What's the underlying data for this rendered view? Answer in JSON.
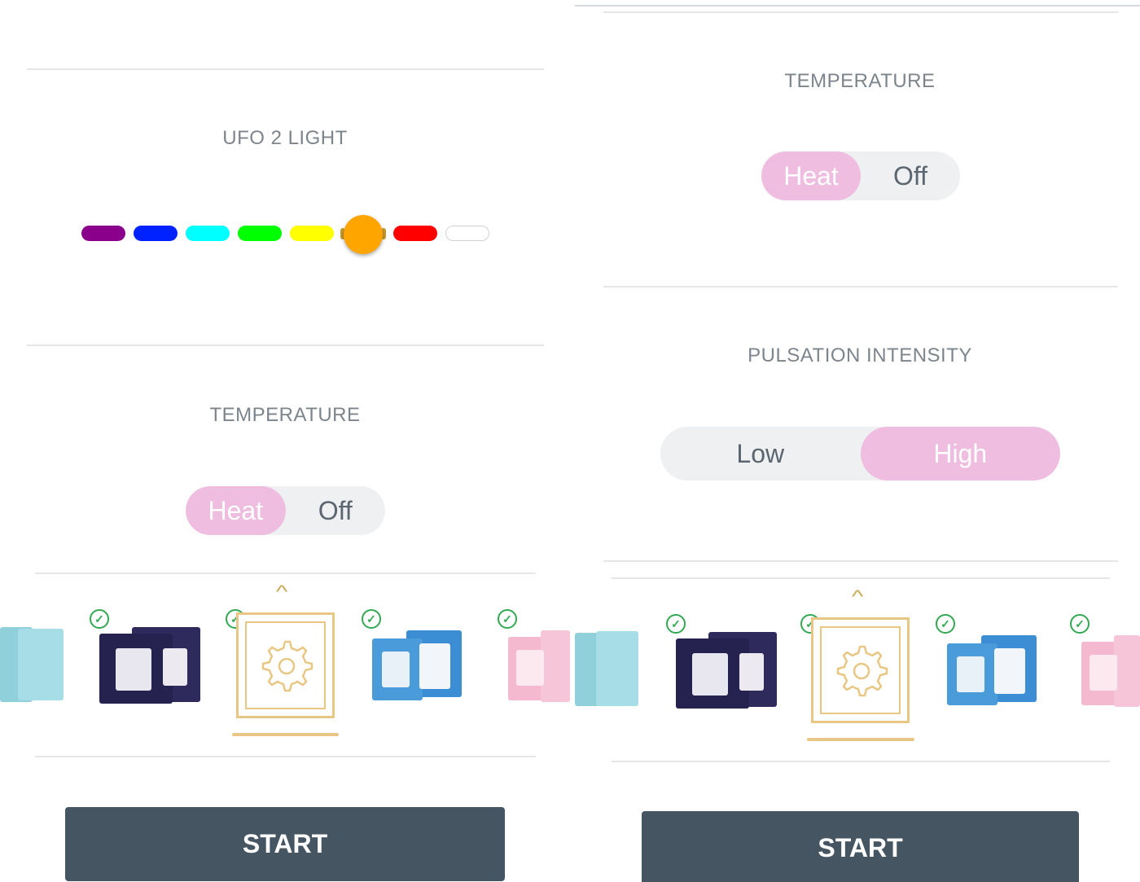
{
  "left": {
    "light": {
      "title": "UFO 2 LIGHT",
      "colors": [
        "#8b008b",
        "#0022ff",
        "#00ffff",
        "#00ff00",
        "#ffff00",
        "#ffa500",
        "#ff0000",
        "#ffffff"
      ],
      "selected_color": "#ffa500"
    },
    "temperature": {
      "title": "TEMPERATURE",
      "options": [
        "Heat",
        "Off"
      ],
      "selected": "Heat"
    },
    "start_label": "START"
  },
  "right": {
    "temperature": {
      "title": "TEMPERATURE",
      "options": [
        "Heat",
        "Off"
      ],
      "selected": "Heat"
    },
    "pulsation": {
      "title": "PULSATION INTENSITY",
      "options": [
        "Low",
        "High"
      ],
      "selected": "High"
    },
    "start_label": "START"
  },
  "icons": {
    "check": "check-circle-icon",
    "gear": "gear-icon",
    "chevron": "chevron-up-icon"
  },
  "colors": {
    "accent_pink": "#efbde0",
    "toggle_bg": "#eef0f2",
    "button": "#455562",
    "gold": "#e8c784",
    "check_green": "#32a852"
  }
}
